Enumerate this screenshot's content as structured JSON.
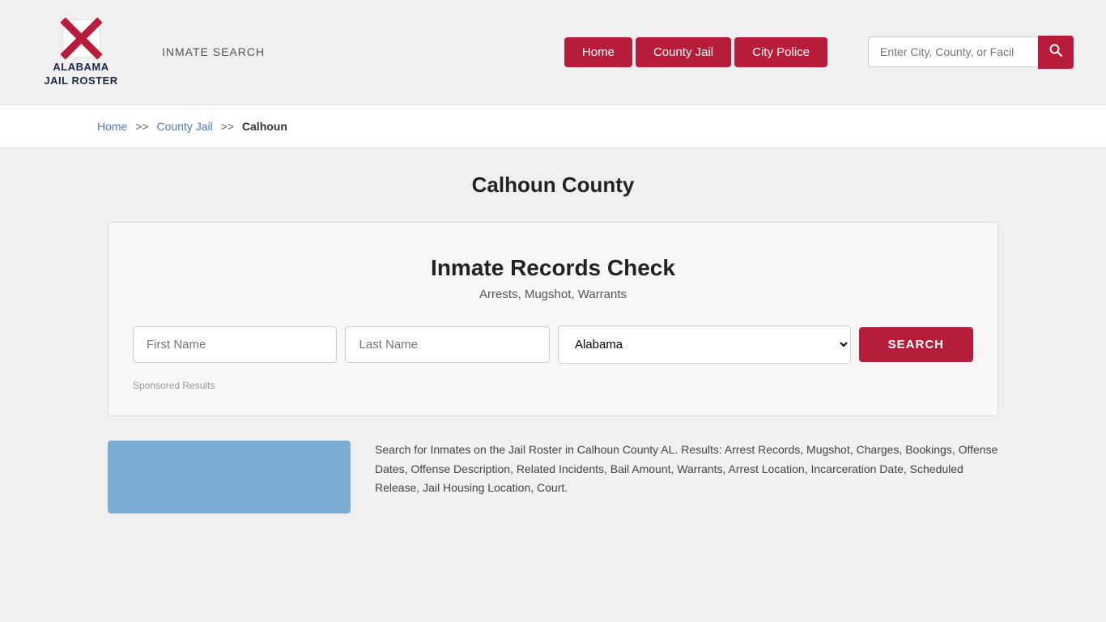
{
  "header": {
    "logo_line1": "ALABAMA",
    "logo_line2": "JAIL ROSTER",
    "inmate_search_label": "INMATE SEARCH",
    "nav": {
      "home_label": "Home",
      "county_jail_label": "County Jail",
      "city_police_label": "City Police"
    },
    "search_placeholder": "Enter City, County, or Facil"
  },
  "breadcrumb": {
    "home": "Home",
    "sep1": ">>",
    "county_jail": "County Jail",
    "sep2": ">>",
    "current": "Calhoun"
  },
  "page_title": "Calhoun County",
  "records_check": {
    "title": "Inmate Records Check",
    "subtitle": "Arrests, Mugshot, Warrants",
    "first_name_placeholder": "First Name",
    "last_name_placeholder": "Last Name",
    "state_default": "Alabama",
    "search_btn": "SEARCH",
    "sponsored_label": "Sponsored Results"
  },
  "bottom": {
    "description": "Search for Inmates on the Jail Roster in Calhoun County AL. Results: Arrest Records, Mugshot, Charges, Bookings, Offense Dates, Offense Description, Related Incidents, Bail Amount, Warrants, Arrest Location, Incarceration Date, Scheduled Release, Jail Housing Location, Court."
  },
  "colors": {
    "brand_red": "#b71c3a",
    "nav_blue": "#4a7abf",
    "dark_navy": "#1a2a4a"
  }
}
